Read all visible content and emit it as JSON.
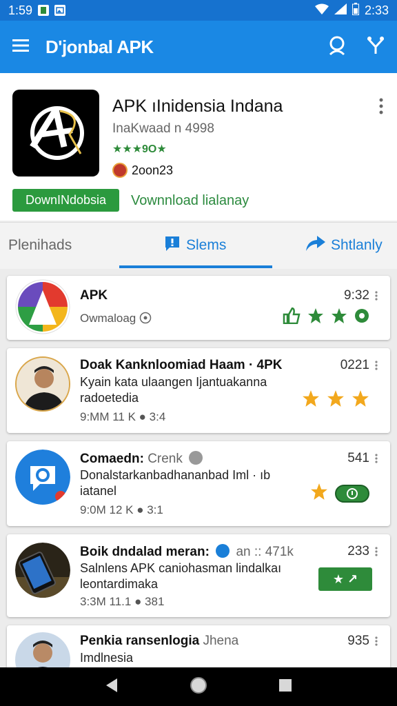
{
  "status_bar": {
    "time_left": "1:59",
    "time_right": "2:33"
  },
  "app_bar": {
    "title": "D'jonbal APK"
  },
  "hero": {
    "title": "APK ıInidensia Indana",
    "subtitle": "InaKwaad n 4998",
    "rating": "★★★9O★",
    "author": "2oon23",
    "download_button": "DownINdobsia",
    "download_link": "Vownnload lialanay"
  },
  "tabs": [
    {
      "label": "Plenihads"
    },
    {
      "label": "Slems"
    },
    {
      "label": "Shtlanly"
    }
  ],
  "cards": [
    {
      "title": "APK",
      "time": "9:32",
      "meta": "Owmaloag"
    },
    {
      "title": "Doak Kanknloomiad Haam · 4PK",
      "time": "0221",
      "body": "Kyain kata ulaangen Ijantuakanna radoetedia",
      "meta": "9:MM 11 K ● 3:4"
    },
    {
      "title": "Comaedn:",
      "title_muted": "Crenk",
      "time": "541",
      "body": "Donalstarkanbadhananbad Iml · ıb iatanel",
      "meta": "9:0M 12 K ● 3:1"
    },
    {
      "title": "Boik dndalad meran:",
      "title_muted": "an :: 471k",
      "time": "233",
      "body": "Salnlens APK caniohasman lindalkaı leontardimaka",
      "meta": "3:3M 11.1 ● 381",
      "button": "★ ↗"
    },
    {
      "title": "Penkia ransenlogia",
      "title_muted": "Jhena",
      "time": "935",
      "body": "Imdlnesia"
    }
  ]
}
